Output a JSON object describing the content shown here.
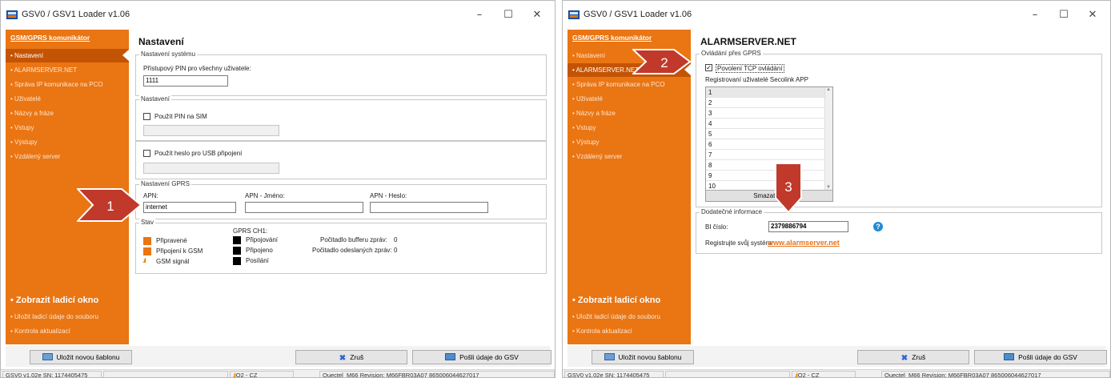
{
  "left": {
    "title": "GSV0 / GSV1 Loader v1.06",
    "sidebar": {
      "header": "GSM/GPRS komunikátor",
      "items": [
        "• Nastavení",
        "• ALARMSERVER.NET",
        "• Správa IP komunikace na PCO",
        "• Uživatelé",
        "• Názvy a fráze",
        "• Vstupy",
        "• Výstupy",
        "• Vzdálený server"
      ],
      "debug": "• Zobrazit ladicí okno",
      "save_debug": "• Uložit ladicí údaje do souboru",
      "check_updates": "• Kontrola aktualizací"
    },
    "page_title": "Nastavení",
    "system": {
      "legend": "Nastavení systému",
      "pin_label": "Přístupový PIN pro všechny uživatele:",
      "pin_value": "1111"
    },
    "settings": {
      "legend": "Nastavení",
      "use_sim_pin": "Použít PIN na SIM",
      "use_usb_password": "Použít heslo pro USB připojení"
    },
    "gprs": {
      "legend": "Nastavení GPRS",
      "apn_label": "APN:",
      "apn_value": "internet",
      "apn_name_label": "APN - Jméno:",
      "apn_pass_label": "APN - Heslo:"
    },
    "status": {
      "legend": "Stav",
      "ready": "Připravené",
      "gsm_connection": "Připojení k GSM",
      "signal_icon": "signal-bars",
      "gsm_signal": "GSM signál",
      "ch_header": "GPRS CH1:",
      "connecting": "Připojování",
      "connected": "Připojeno",
      "sending": "Posílání",
      "buffer_label": "Počitadlo bufferu zpráv:",
      "buffer_value": "0",
      "sent_label": "Počitadlo odeslaných zpráv:",
      "sent_value": "0"
    },
    "callout": "1"
  },
  "right": {
    "title": "GSV0 / GSV1 Loader v1.06",
    "page_title": "ALARMSERVER.NET",
    "control": {
      "legend": "Ovládání přes GPRS",
      "enable_tcp": "Povolení TCP ovládání",
      "enable_tcp_checked": true,
      "users_label": "Registrovaní uživatelé Secolink APP",
      "rows": [
        "1",
        "2",
        "3",
        "4",
        "5",
        "6",
        "7",
        "8",
        "9",
        "10"
      ],
      "clear_button": "Smazat vyt"
    },
    "extra": {
      "legend": "Dodatečné informace",
      "bi_label": "BI číslo:",
      "bi_value": "2379886794",
      "help_icon": "?",
      "register_label": "Registrujte svůj systém:",
      "register_link": "www.alarmserver.net"
    },
    "callout2": "2",
    "callout3": "3"
  },
  "common": {
    "save_template": "Uložit novou šablonu",
    "cancel": "Zruš",
    "send": "Pošli údaje do GSV",
    "status_fw": "GSV0 v1.02e SN: 1174405475",
    "status_operator": "O2 - CZ",
    "status_modem": "Quectel_M66 Revision: M66FBR03A07 865006044627017",
    "accent_color": "#ea7513",
    "callout_color": "#c0392b"
  }
}
